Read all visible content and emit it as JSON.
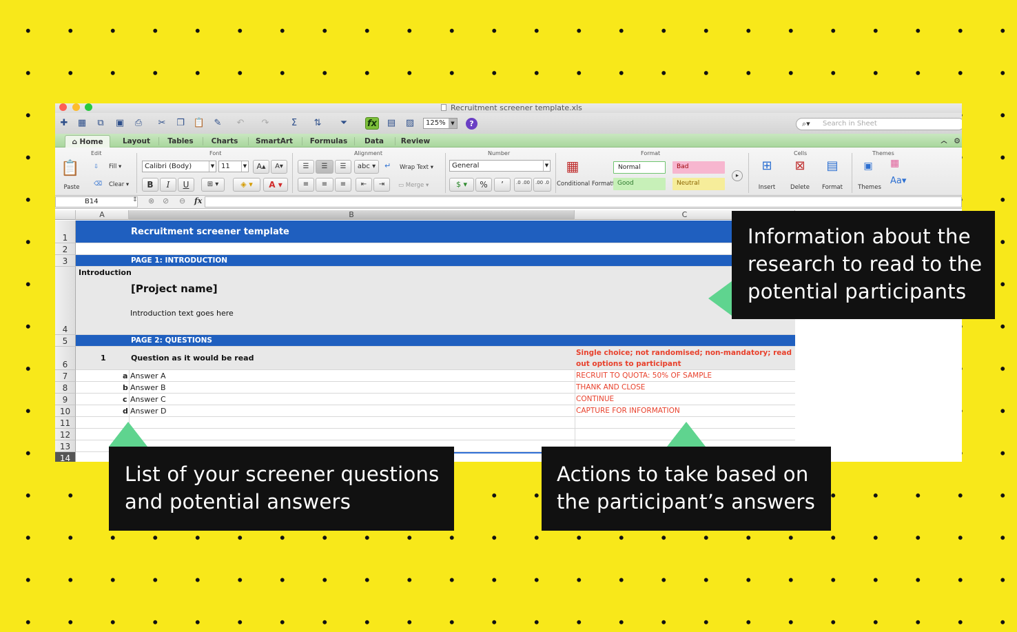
{
  "window": {
    "title": "Recruitment screener template.xls"
  },
  "toolbar": {
    "zoom": "125%",
    "search_placeholder": "Search in Sheet"
  },
  "tabs": [
    "Home",
    "Layout",
    "Tables",
    "Charts",
    "SmartArt",
    "Formulas",
    "Data",
    "Review"
  ],
  "ribbon": {
    "groups": {
      "edit": "Edit",
      "font": "Font",
      "alignment": "Alignment",
      "number": "Number",
      "format": "Format",
      "cells": "Cells",
      "themes": "Themes"
    },
    "paste": "Paste",
    "fill": "Fill",
    "clear": "Clear",
    "font_name": "Calibri (Body)",
    "font_size": "11",
    "bold": "B",
    "italic": "I",
    "underline": "U",
    "wrap_text": "Wrap Text",
    "merge": "Merge",
    "abc": "abc",
    "number_format": "General",
    "percent": "%",
    "comma": "’",
    "dec_inc": ".0 .00",
    "dec_dec": ".00 .0",
    "conditional_formatting": "Conditional Formatting",
    "styles": {
      "normal": "Normal",
      "bad": "Bad",
      "good": "Good",
      "neutral": "Neutral"
    },
    "insert": "Insert",
    "delete": "Delete",
    "format": "Format",
    "themes": "Themes",
    "aa": "Aa"
  },
  "formula_bar": {
    "name_box": "B14",
    "fx": "fx"
  },
  "columns": [
    "A",
    "B",
    "C"
  ],
  "rows": [
    {
      "num": "1",
      "a": "",
      "b": "Recruitment screener template",
      "c": ""
    },
    {
      "num": "2",
      "a": "",
      "b": "",
      "c": ""
    },
    {
      "num": "3",
      "a": "",
      "b": "PAGE 1: INTRODUCTION",
      "c": ""
    },
    {
      "num": "4",
      "a": "Introduction",
      "b_title": "[Project name]",
      "b": "Introduction text goes here",
      "c": ""
    },
    {
      "num": "5",
      "a": "",
      "b": "PAGE 2: QUESTIONS",
      "c": ""
    },
    {
      "num": "6",
      "a": "1",
      "b": "Question as it would be read",
      "c": "Single choice; not randomised; non-mandatory; read out options to participant"
    },
    {
      "num": "7",
      "a": "a",
      "b": "Answer A",
      "c": "RECRUIT TO QUOTA: 50% OF SAMPLE"
    },
    {
      "num": "8",
      "a": "b",
      "b": "Answer B",
      "c": "THANK AND CLOSE"
    },
    {
      "num": "9",
      "a": "c",
      "b": "Answer C",
      "c": "CONTINUE"
    },
    {
      "num": "10",
      "a": "d",
      "b": "Answer D",
      "c": "CAPTURE FOR INFORMATION"
    },
    {
      "num": "11"
    },
    {
      "num": "12"
    },
    {
      "num": "13"
    },
    {
      "num": "14"
    }
  ],
  "callouts": {
    "info": "Information about the research to read to the potential participants",
    "questions": "List of your screener questions and potential answers",
    "actions": "Actions to take based on the participant’s answers"
  },
  "colors": {
    "background": "#f8e81a",
    "callout": "#111111",
    "arrow": "#5fd48f",
    "header_blue": "#1f5fbf",
    "action_red": "#e8412c",
    "ribbon_green": "#b7dfac"
  }
}
